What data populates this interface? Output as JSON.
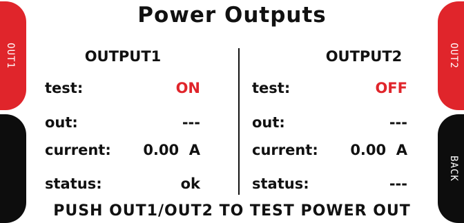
{
  "title": "Power Outputs",
  "left_tabs": [
    {
      "label": "OUT1",
      "color": "#e0252b"
    },
    {
      "label": "",
      "color": "#0d0d0d"
    }
  ],
  "right_tabs": [
    {
      "label": "OUT2",
      "color": "#e0252b"
    },
    {
      "label": "BACK",
      "color": "#0d0d0d"
    }
  ],
  "output1": {
    "header": "OUTPUT1",
    "rows": [
      {
        "label": "test:",
        "value": "ON"
      },
      {
        "label": "out:",
        "value": "---"
      },
      {
        "label": "current:",
        "value": "0.00  A"
      },
      {
        "label": "status:",
        "value": "ok"
      }
    ]
  },
  "output2": {
    "header": "OUTPUT2",
    "rows": [
      {
        "label": "test:",
        "value": "OFF"
      },
      {
        "label": "out:",
        "value": "---"
      },
      {
        "label": "current:",
        "value": "0.00  A"
      },
      {
        "label": "status:",
        "value": "---"
      }
    ]
  },
  "footer": "PUSH OUT1/OUT2 TO TEST POWER OUT",
  "colors": {
    "accent": "#e0252b",
    "text": "#111111",
    "background": "#ffffff"
  }
}
